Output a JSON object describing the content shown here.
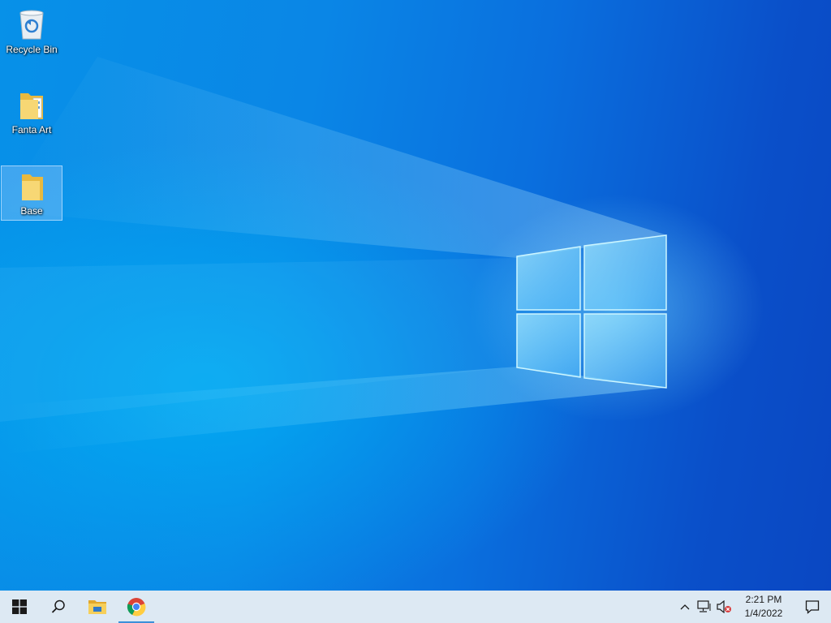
{
  "desktop": {
    "icons": [
      {
        "label": "Recycle Bin",
        "icon": "recycle-bin-icon"
      },
      {
        "label": "Fanta Art",
        "icon": "folder-icon"
      },
      {
        "label": "Base",
        "icon": "folder-icon"
      }
    ]
  },
  "taskbar": {
    "start": {
      "icon": "windows-logo-icon"
    },
    "search": {
      "icon": "search-icon"
    },
    "apps": [
      {
        "name": "File Explorer",
        "icon": "file-explorer-icon"
      },
      {
        "name": "Google Chrome",
        "icon": "chrome-icon"
      }
    ],
    "tray": {
      "icons": [
        "chevron-up-icon",
        "network-icon",
        "volume-muted-icon"
      ],
      "time": "2:21 PM",
      "date": "1/4/2022",
      "notifications_icon": "action-center-icon"
    }
  },
  "colors": {
    "wallpaper_dark": "#0a47c2",
    "wallpaper_light": "#0791e8",
    "taskbar_bg": "#dde9f3",
    "selection_accent": "#3c8fd9"
  }
}
